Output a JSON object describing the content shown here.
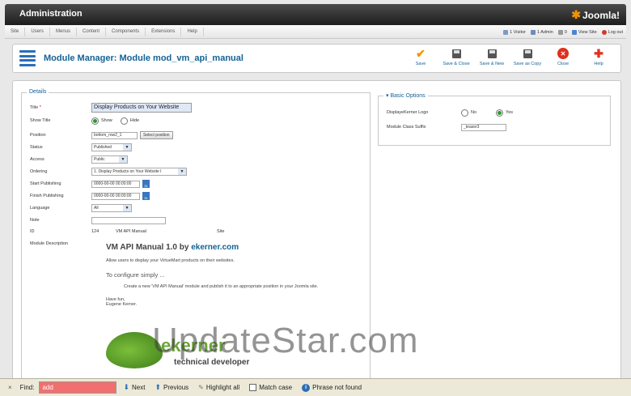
{
  "header": {
    "title": "Administration",
    "logo_text": "Joomla!"
  },
  "menu": [
    "Site",
    "Users",
    "Menus",
    "Content",
    "Components",
    "Extensions",
    "Help"
  ],
  "status": {
    "visitors": "1 Visitor",
    "admins": "1 Admin",
    "messages": "0",
    "view_site": "View Site",
    "logout": "Log out"
  },
  "toolbar": {
    "page_title": "Module Manager: Module mod_vm_api_manual",
    "buttons": [
      "Save",
      "Save & Close",
      "Save & New",
      "Save as Copy",
      "Close",
      "Help"
    ]
  },
  "details": {
    "legend": "Details",
    "title_label": "Title",
    "title_required": "*",
    "title_value": "Display Products on Your Website",
    "show_title_label": "Show Title",
    "show_title_options": [
      "Show",
      "Hide"
    ],
    "position_label": "Position",
    "position_value": "bottom_row2_1",
    "select_position_button": "Select position",
    "status_label": "Status",
    "status_value": "Published",
    "access_label": "Access",
    "access_value": "Public",
    "ordering_label": "Ordering",
    "ordering_value": "1. Display Products on Your Website I",
    "start_label": "Start Publishing",
    "start_value": "0000-00-00 00:00:00",
    "finish_label": "Finish Publishing",
    "finish_value": "0000-00-00 00:00:00",
    "language_label": "Language",
    "language_value": "All",
    "note_label": "Note",
    "note_value": "",
    "id_label": "ID",
    "id_value": "124",
    "module_name": "VM API Manual",
    "client": "Site",
    "desc_label": "Module Description"
  },
  "description": {
    "heading": "VM API Manual 1.0 by ",
    "heading_link": "ekerner.com",
    "intro": "Allow users to display your VirtueMart products on their websites.",
    "configure": "To configure simply ...",
    "step": "Create a new 'VM API Manual' module and publish it to an appropriate position in your Joomla site.",
    "signoff1": "Have fun,",
    "signoff2": "Eugene Kerner.",
    "logo_text": "ekerner",
    "logo_sub": "technical developer"
  },
  "basic_options": {
    "legend": "Basic Options",
    "display_logo_label": "DisplayeKerner Logo",
    "display_logo_options": [
      "No",
      "Yes"
    ],
    "class_suffix_label": "Module Class Suffix",
    "class_suffix_value": "_teaser3"
  },
  "watermark": "UpdateStar.com",
  "findbar": {
    "close": "×",
    "label": "Find:",
    "value": "add",
    "next": "Next",
    "previous": "Previous",
    "highlight": "Highlight all",
    "match_case": "Match case",
    "status": "Phrase not found"
  }
}
